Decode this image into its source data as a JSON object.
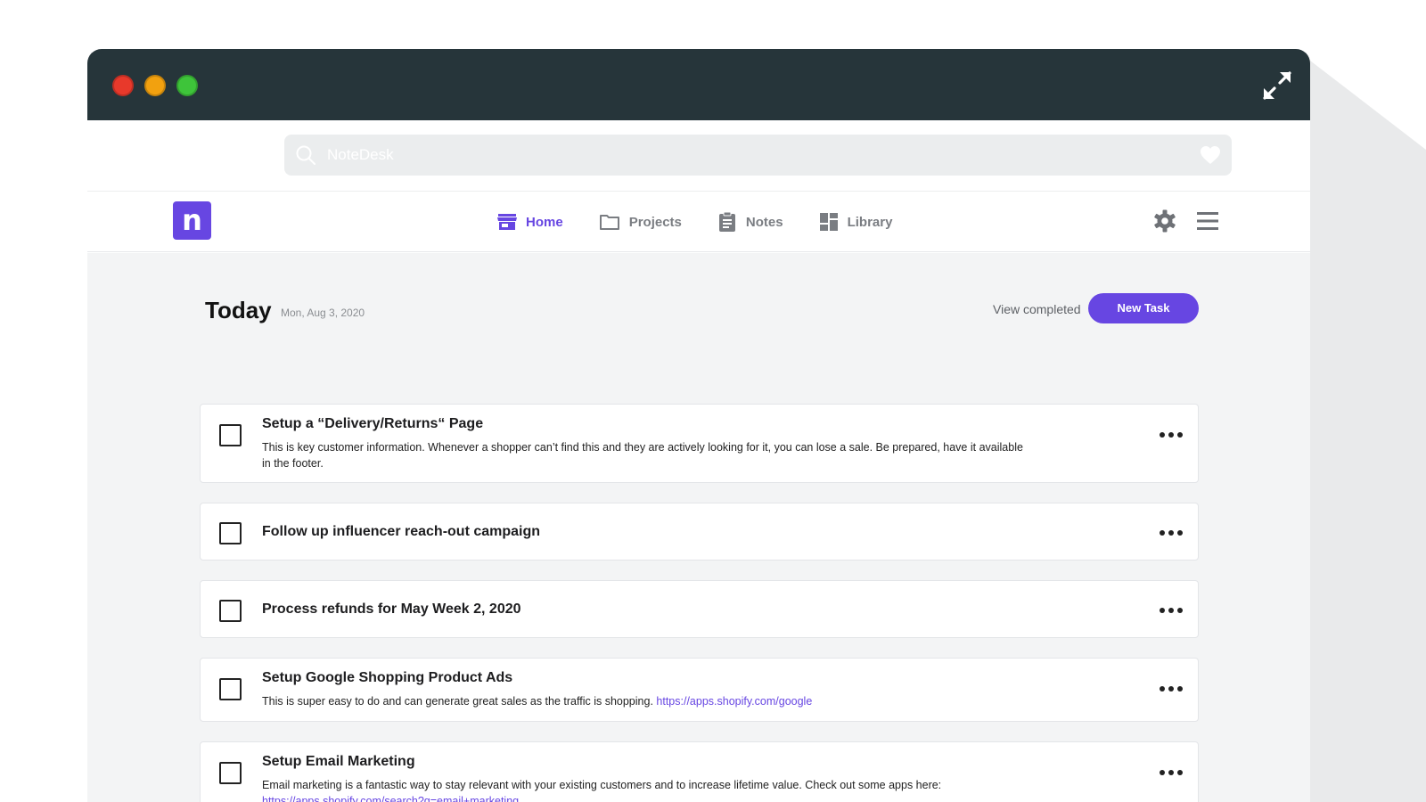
{
  "browser": {
    "address_text": "NoteDesk",
    "dot_colors": [
      "#e8392b",
      "#f2a10f",
      "#3ec43a"
    ]
  },
  "app": {
    "logo_letter": "n",
    "accent_color": "#6746e2"
  },
  "nav": {
    "tabs": [
      {
        "label": "Home",
        "icon": "store-icon",
        "active": true
      },
      {
        "label": "Projects",
        "icon": "folder-icon",
        "active": false
      },
      {
        "label": "Notes",
        "icon": "clipboard-icon",
        "active": false
      },
      {
        "label": "Library",
        "icon": "dashboard-icon",
        "active": false
      }
    ]
  },
  "header": {
    "title": "Today",
    "date": "Mon, Aug 3, 2020",
    "view_completed": "View completed",
    "new_task": "New Task"
  },
  "tasks": [
    {
      "title": "Setup a “Delivery/Returns“ Page",
      "description": "This is key customer information. Whenever a shopper can’t find this and they are actively looking for it, you can lose a sale. Be prepared, have it available in the footer.",
      "link": ""
    },
    {
      "title": "Follow up influencer reach-out campaign",
      "description": "",
      "link": ""
    },
    {
      "title": "Process refunds for May Week 2, 2020",
      "description": "",
      "link": ""
    },
    {
      "title": "Setup Google Shopping Product Ads",
      "description": "This is super easy to do and can generate great sales as the traffic is shopping.",
      "link": "https://apps.shopify.com/google"
    },
    {
      "title": "Setup Email Marketing",
      "description": "Email marketing is a fantastic way to stay relevant with your existing customers and to increase lifetime value. Check out some apps here:",
      "link": "https://apps.shopify.com/search?q=email+marketing"
    }
  ]
}
